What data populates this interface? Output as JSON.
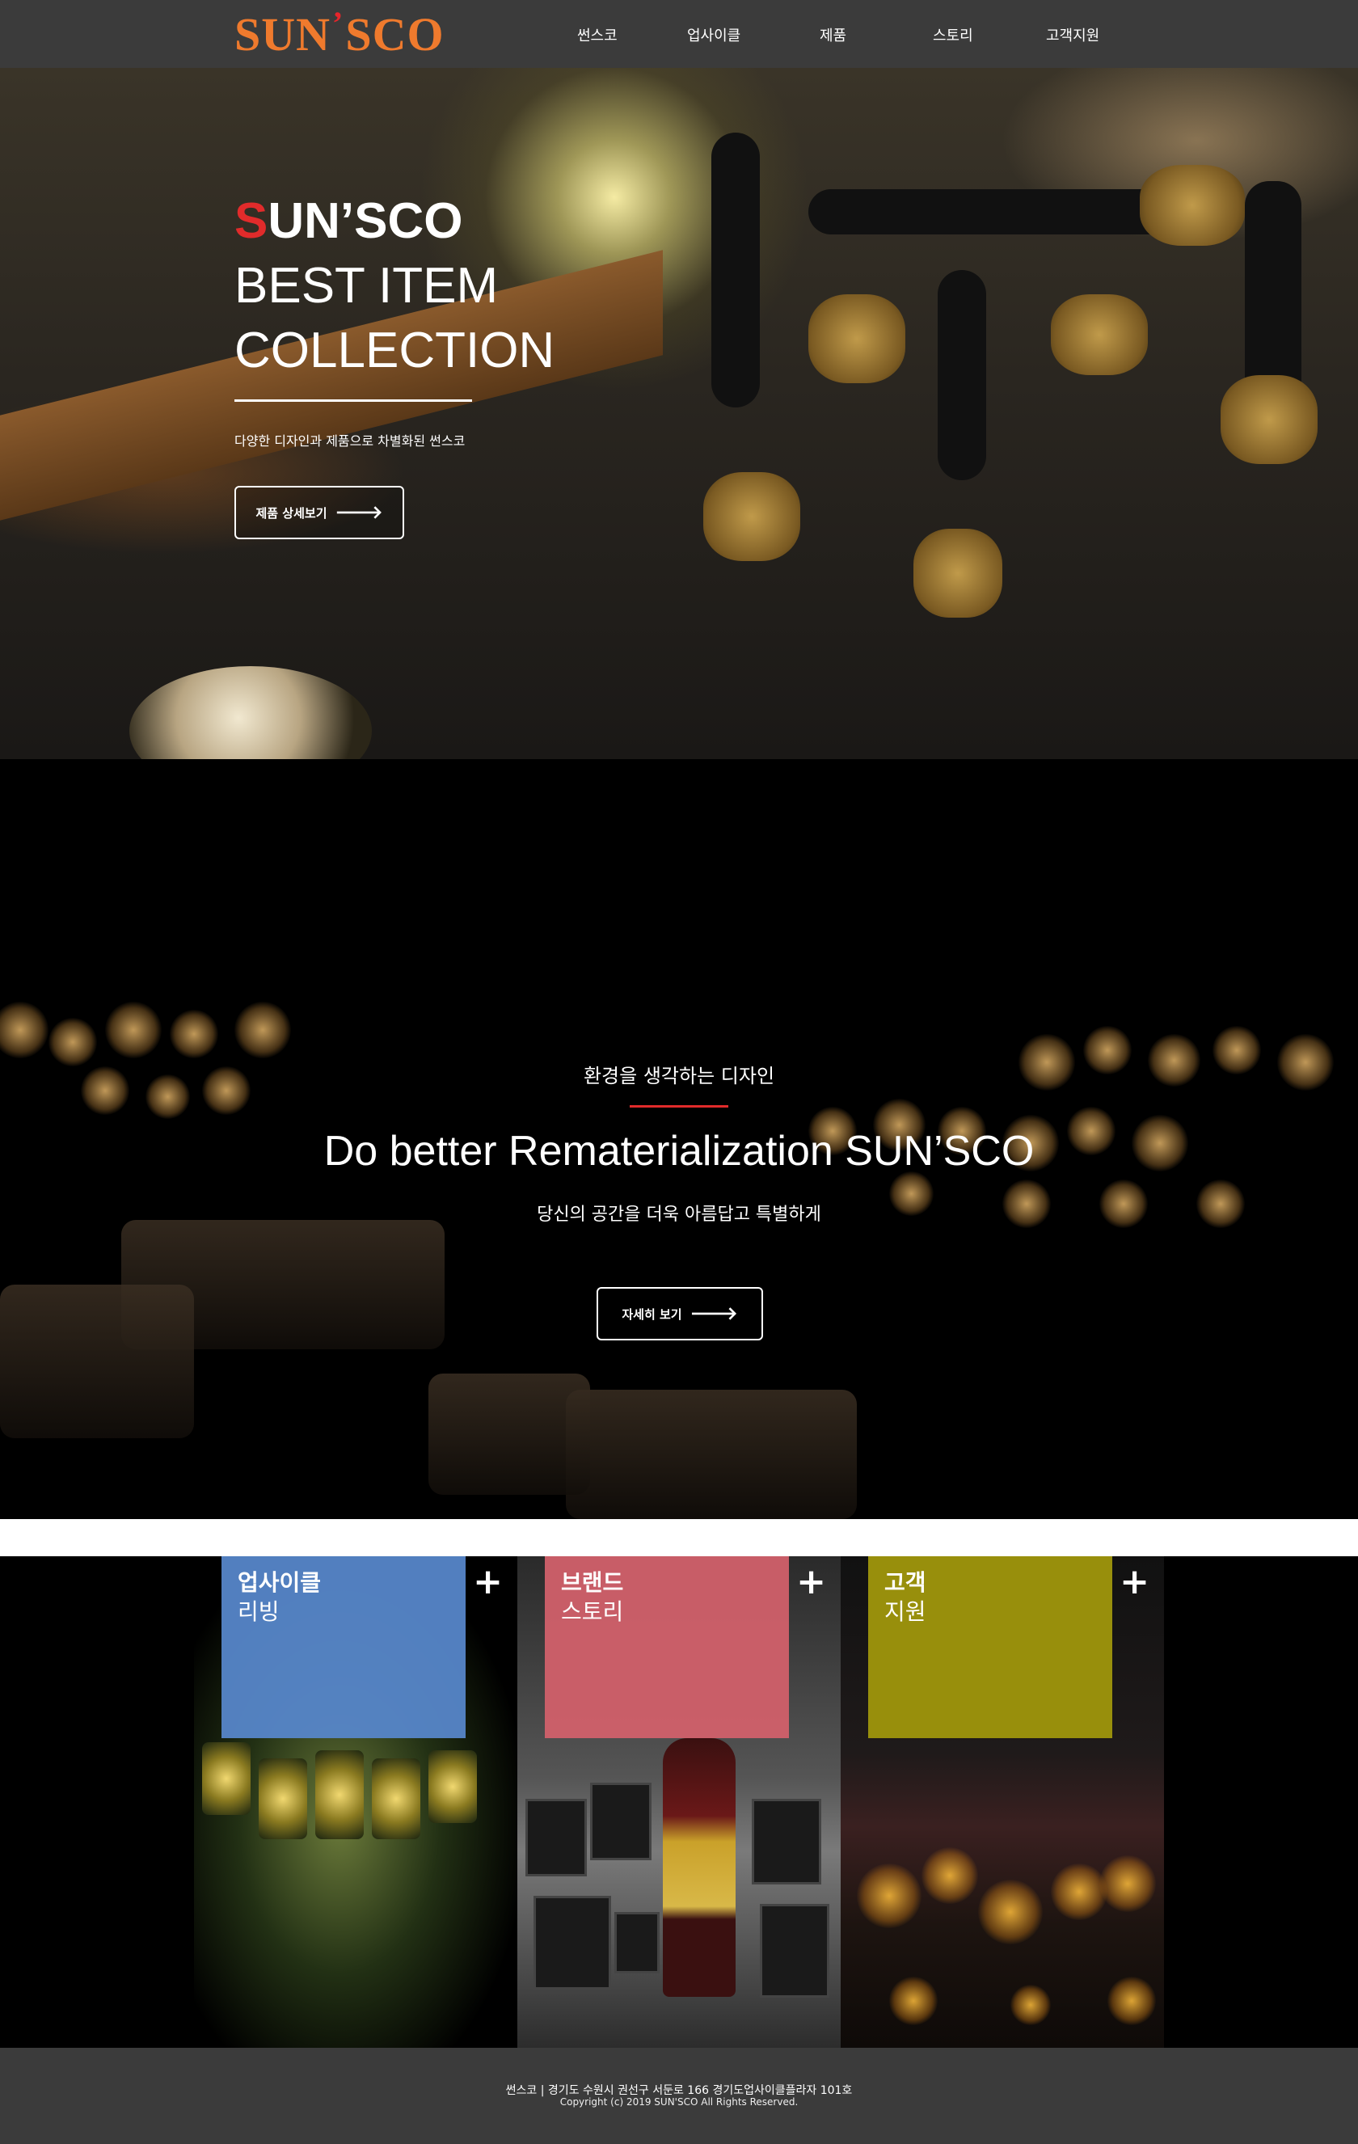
{
  "nav": {
    "logo": {
      "main": "SUN",
      "tick": "’",
      "tail": "SCO"
    },
    "items": [
      "썬스코",
      "업사이클",
      "제품",
      "스토리",
      "고객지원"
    ]
  },
  "hero": {
    "title_red": "S",
    "title_line1_rest": "UN’SCO",
    "title_line2": "BEST ITEM",
    "title_line3": "COLLECTION",
    "description": "다양한 디자인과 제품으로 차별화된 썬스코",
    "button_label": "제품 상세보기",
    "arrow": "🡒"
  },
  "feature": {
    "subtitle": "환경을 생각하는 디자인",
    "title": "Do better Rematerialization SUN’SCO",
    "description": "당신의 공간을 더욱 아름답고 특별하게",
    "button_label": "자세히 보기",
    "arrow": "🡒"
  },
  "cards": [
    {
      "title": "업사이클",
      "subtitle": "리빙",
      "plus": "+",
      "color": "#5686c9"
    },
    {
      "title": "브랜드",
      "subtitle": "스토리",
      "plus": "+",
      "color": "#d1606a"
    },
    {
      "title": "고객",
      "subtitle": "지원",
      "plus": "+",
      "color": "#988f0c"
    }
  ],
  "footer": {
    "line1": "썬스코 | 경기도 수원시 권선구 서둔로 166 경기도업사이클플라자 101호",
    "line2": "Copyright (c) 2019 SUN'SCO All Rights Reserved."
  },
  "colors": {
    "nav_bg": "#3b3b3b",
    "logo": "#ef7a2d",
    "accent_red": "#e12b2b"
  }
}
